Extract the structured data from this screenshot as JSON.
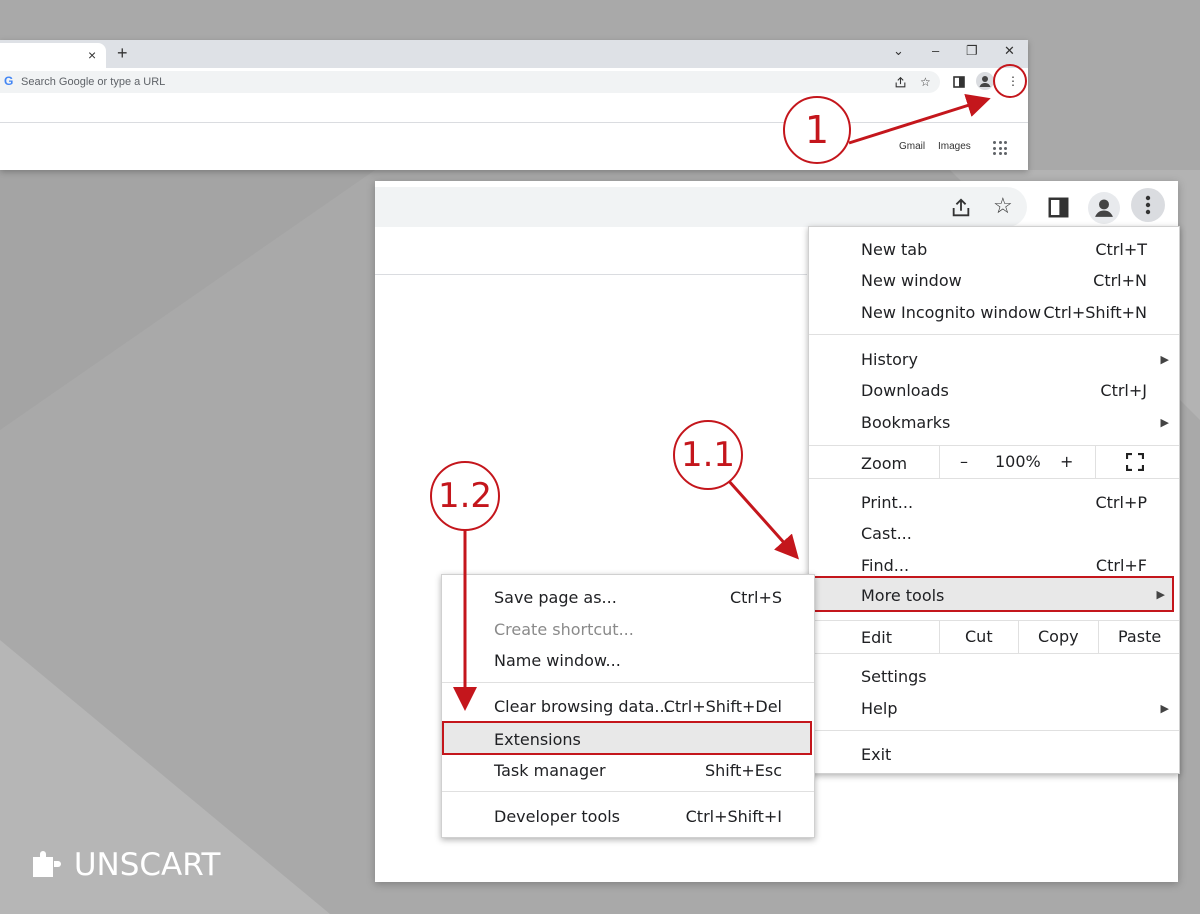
{
  "top_browser": {
    "tab_close": "×",
    "new_tab": "+",
    "win_dropdown": "⌄",
    "win_minimize": "–",
    "win_restore": "❐",
    "win_close": "✕",
    "google_g": "G",
    "omnibox_placeholder": "Search Google or type a URL",
    "gmail": "Gmail",
    "images": "Images"
  },
  "main_menu": {
    "new_tab": {
      "label": "New tab",
      "shortcut": "Ctrl+T"
    },
    "new_window": {
      "label": "New window",
      "shortcut": "Ctrl+N"
    },
    "new_incognito": {
      "label": "New Incognito window",
      "shortcut": "Ctrl+Shift+N"
    },
    "history": {
      "label": "History"
    },
    "downloads": {
      "label": "Downloads",
      "shortcut": "Ctrl+J"
    },
    "bookmarks": {
      "label": "Bookmarks"
    },
    "zoom": {
      "label": "Zoom",
      "minus": "–",
      "value": "100%",
      "plus": "+"
    },
    "print": {
      "label": "Print...",
      "shortcut": "Ctrl+P"
    },
    "cast": {
      "label": "Cast..."
    },
    "find": {
      "label": "Find...",
      "shortcut": "Ctrl+F"
    },
    "more_tools": {
      "label": "More tools"
    },
    "edit": {
      "label": "Edit",
      "cut": "Cut",
      "copy": "Copy",
      "paste": "Paste"
    },
    "settings": {
      "label": "Settings"
    },
    "help": {
      "label": "Help"
    },
    "exit": {
      "label": "Exit"
    }
  },
  "submenu": {
    "save_page": {
      "label": "Save page as...",
      "shortcut": "Ctrl+S"
    },
    "create_shortcut": {
      "label": "Create shortcut..."
    },
    "name_window": {
      "label": "Name window..."
    },
    "clear_data": {
      "label": "Clear browsing data...",
      "shortcut": "Ctrl+Shift+Del"
    },
    "extensions": {
      "label": "Extensions"
    },
    "task_manager": {
      "label": "Task manager",
      "shortcut": "Shift+Esc"
    },
    "dev_tools": {
      "label": "Developer tools",
      "shortcut": "Ctrl+Shift+I"
    }
  },
  "callouts": {
    "step1": "1",
    "step1_1": "1.1",
    "step1_2": "1.2"
  },
  "brand": {
    "name": "UNSCART"
  },
  "colors": {
    "accent": "#c4161c",
    "background": "#a9a9a9",
    "menu_highlight": "#e8e8e8"
  }
}
